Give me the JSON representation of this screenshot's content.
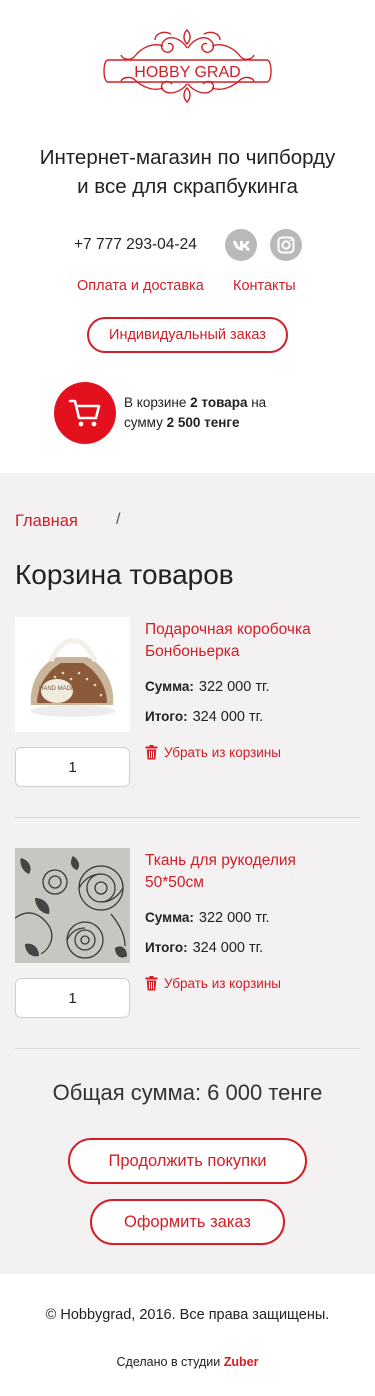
{
  "brand": {
    "logo_text": "HOBBY GRAD",
    "accent_color": "#d31e26",
    "cart_color": "#e3101d"
  },
  "header": {
    "tagline_line1": "Интернет-магазин по чипборду",
    "tagline_line2": "и все для скрапбукинга",
    "phone": "+7 777 293-04-24",
    "social": [
      "vk-icon",
      "instagram-icon"
    ],
    "links": {
      "payment": "Оплата и доставка",
      "contacts": "Контакты"
    },
    "individual_order": "Индивидуальный заказ",
    "cart": {
      "prefix": "В корзине ",
      "count": "2 товара",
      "middle": " на",
      "sum_prefix": "сумму ",
      "sum": "2 500 тенге"
    }
  },
  "breadcrumb": {
    "home": "Главная",
    "separator": "/"
  },
  "page_title": "Корзина товаров",
  "items": [
    {
      "name_line1": "Подарочная коробочка",
      "name_line2": "Бонбоньерка",
      "sum_label": "Сумма:",
      "sum_value": "322 000 тг.",
      "total_label": "Итого:",
      "total_value": "324 000 тг.",
      "remove": "Убрать из корзины",
      "qty": "1",
      "image_badge": "HAND MADE"
    },
    {
      "name_line1": "Ткань для рукоделия",
      "name_line2": "50*50см",
      "sum_label": "Сумма:",
      "sum_value": "322 000 тг.",
      "total_label": "Итого:",
      "total_value": "324 000 тг.",
      "remove": "Убрать из корзины",
      "qty": "1"
    }
  ],
  "summary": {
    "total": "Общая сумма: 6 000 тенге",
    "continue": "Продолжить покупки",
    "checkout": "Оформить заказ"
  },
  "footer": {
    "copyright": "© Hobbygrad, 2016. Все права защищены.",
    "made_prefix": "Сделано в студии ",
    "studio": "Zuber"
  }
}
